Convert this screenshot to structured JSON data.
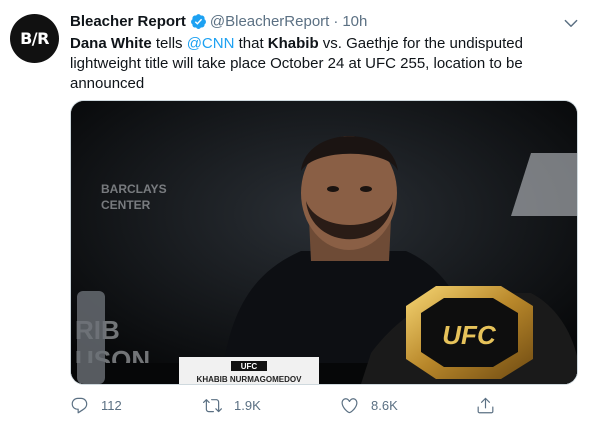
{
  "tweet": {
    "avatar_text": "B/R",
    "author_name": "Bleacher Report",
    "handle": "@BleacherReport",
    "separator": "·",
    "time": "10h",
    "text_parts": {
      "p1": "Dana White",
      "p2": " tells ",
      "p3": "@CNN",
      "p4": " that ",
      "p5": "Khabib",
      "p6": " vs. Gaethje for the undisputed lightweight title will take place October 24 at UFC 255, location to be announced"
    },
    "media": {
      "description_icon": "photo",
      "backdrop_text": [
        "BARCLAYS",
        "CENTER",
        "RIB",
        "USON"
      ],
      "nameplate_logo": "UFC",
      "nameplate_text": "KHABIB NURMAGOMEDOV",
      "belt_text": "UFC"
    },
    "actions": {
      "reply_count": "112",
      "retweet_count": "1.9K",
      "like_count": "8.6K"
    }
  },
  "colors": {
    "accent": "#1da1f2",
    "secondary_text": "#5b7083"
  }
}
